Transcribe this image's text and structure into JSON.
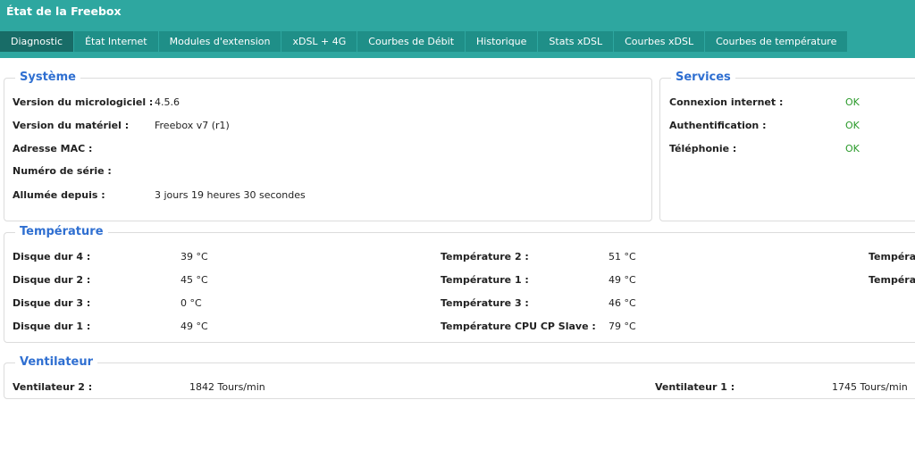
{
  "window": {
    "title": "État de la Freebox"
  },
  "tabs": [
    {
      "label": "Diagnostic",
      "active": true
    },
    {
      "label": "État Internet"
    },
    {
      "label": "Modules d'extension"
    },
    {
      "label": "xDSL + 4G"
    },
    {
      "label": "Courbes de Débit"
    },
    {
      "label": "Historique"
    },
    {
      "label": "Stats xDSL"
    },
    {
      "label": "Courbes xDSL"
    },
    {
      "label": "Courbes de température"
    }
  ],
  "systeme": {
    "title": "Système",
    "rows": [
      {
        "label": "Version du micrologiciel :",
        "value": "4.5.6"
      },
      {
        "label": "Version du matériel :",
        "value": "Freebox v7 (r1)"
      },
      {
        "label": "Adresse MAC :",
        "value": ""
      },
      {
        "label": "Numéro de série :",
        "value": ""
      },
      {
        "label": "Allumée depuis :",
        "value": "3 jours 19 heures 30 secondes"
      }
    ]
  },
  "services": {
    "title": "Services",
    "rows": [
      {
        "label": "Connexion internet :",
        "value": "OK"
      },
      {
        "label": "Authentification :",
        "value": "OK"
      },
      {
        "label": "Téléphonie :",
        "value": "OK"
      }
    ]
  },
  "temperature": {
    "title": "Température",
    "col1": [
      {
        "label": "Disque dur 4 :",
        "value": "39 °C"
      },
      {
        "label": "Disque dur 2 :",
        "value": "45 °C"
      },
      {
        "label": "Disque dur 3 :",
        "value": "0 °C"
      },
      {
        "label": "Disque dur 1 :",
        "value": "49 °C"
      }
    ],
    "col2": [
      {
        "label": "Température 2 :",
        "value": "51 °C"
      },
      {
        "label": "Température 1 :",
        "value": "49 °C"
      },
      {
        "label": "Température 3 :",
        "value": "46 °C"
      },
      {
        "label": "Température CPU CP Slave :",
        "value": "79 °C"
      }
    ],
    "col3": [
      {
        "label": "Températ"
      },
      {
        "label": "Températ"
      }
    ]
  },
  "ventilateur": {
    "title": "Ventilateur",
    "rows": [
      {
        "label": "Ventilateur 2 :",
        "value": "1842 Tours/min"
      },
      {
        "label": "Ventilateur 1 :",
        "value": "1745 Tours/min"
      }
    ]
  },
  "colors": {
    "header": "#2ea7a0",
    "tab": "#1f8f88",
    "tab_active": "#186c67",
    "legend": "#2f6fd1",
    "ok": "#2a9a2a"
  }
}
